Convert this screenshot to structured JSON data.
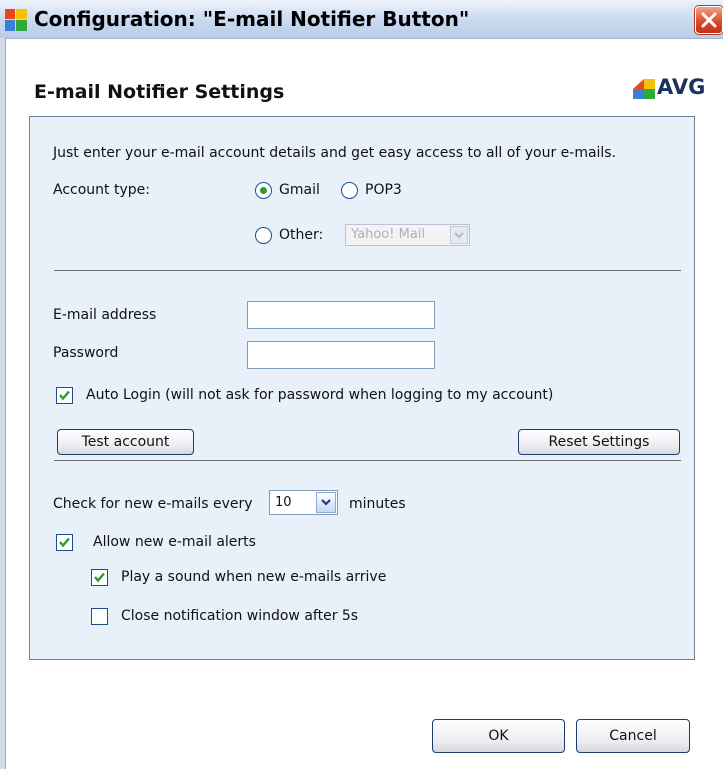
{
  "window": {
    "title": "Configuration: \"E-mail Notifier Button\""
  },
  "header": {
    "heading": "E-mail Notifier Settings",
    "logo_text": "AVG"
  },
  "panel": {
    "intro": "Just enter your e-mail account details and get easy access to all of your e-mails.",
    "account_type_label": "Account type:",
    "options": {
      "gmail": "Gmail",
      "pop3": "POP3",
      "other": "Other:"
    },
    "selected_option": "Gmail",
    "other_provider": {
      "value": "Yahoo! Mail",
      "disabled": true
    },
    "email_label": "E-mail address",
    "email_value": "",
    "password_label": "Password",
    "password_value": "",
    "auto_login_label": "Auto Login (will not ask for password when logging to my account)",
    "auto_login_checked": true,
    "test_account_button": "Test account",
    "reset_settings_button": "Reset Settings",
    "check_prefix": "Check for new e-mails every",
    "check_interval": "10",
    "check_suffix": "minutes",
    "allow_alerts_label": "Allow new e-mail alerts",
    "allow_alerts_checked": true,
    "play_sound_label": "Play a sound when new e-mails arrive",
    "play_sound_checked": true,
    "close_window_label": "Close notification window after 5s",
    "close_window_checked": false
  },
  "footer": {
    "ok_button": "OK",
    "cancel_button": "Cancel"
  },
  "colors": {
    "title_bar": "#c9d9f0",
    "panel_background": "#e8f0fa",
    "checkmark": "#2f9a2f",
    "close_button": "#d9472b"
  },
  "icons": [
    "avg-app-icon",
    "close-icon",
    "avg-logo-icon",
    "chevron-down-icon",
    "checkmark-icon"
  ]
}
